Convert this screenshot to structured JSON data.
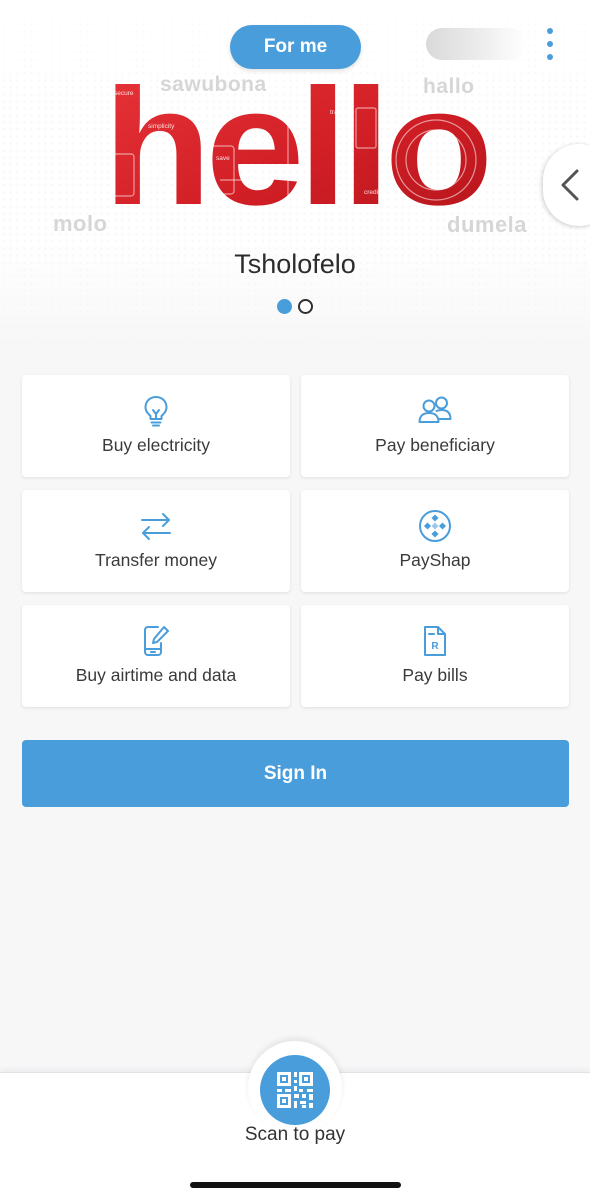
{
  "header": {
    "mode_button_label": "For me",
    "menu_icon": "kebab-menu-icon"
  },
  "hero": {
    "headline": "hello",
    "greetings": {
      "sawubona": "sawubona",
      "hallo": "hallo",
      "molo": "molo",
      "dumela": "dumela"
    },
    "artwork_words": [
      "secure",
      "simplicity",
      "transact",
      "save",
      "credit"
    ],
    "user_name": "Tsholofelo",
    "carousel": {
      "total": 2,
      "active_index": 0
    },
    "side_tab_icon": "chevron-left-icon",
    "brand_red": "#d8252a"
  },
  "actions": [
    {
      "label": "Buy electricity",
      "icon": "lightbulb-icon"
    },
    {
      "label": "Pay beneficiary",
      "icon": "people-icon"
    },
    {
      "label": "Transfer money",
      "icon": "transfer-arrows-icon"
    },
    {
      "label": "PayShap",
      "icon": "payshap-icon"
    },
    {
      "label": "Buy airtime and data",
      "icon": "phone-edit-icon"
    },
    {
      "label": "Pay bills",
      "icon": "bill-icon"
    }
  ],
  "sign_in": {
    "label": "Sign In"
  },
  "bottom_bar": {
    "scan_label": "Scan to pay",
    "scan_icon": "qr-code-icon"
  },
  "colors": {
    "accent": "#4a9ddb",
    "background": "#f7f7f8",
    "text": "#333333"
  }
}
